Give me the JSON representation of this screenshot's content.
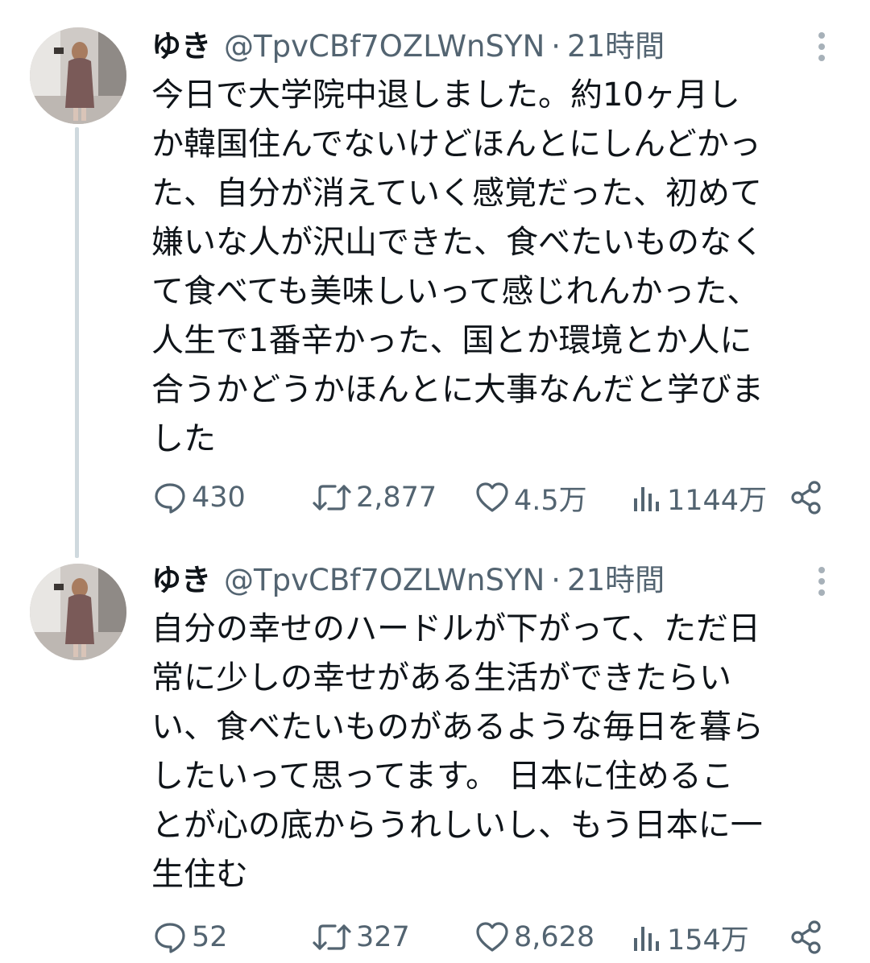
{
  "tweets": [
    {
      "display_name": "ゆき",
      "handle": "@TpvCBf7OZLWnSYN",
      "separator": "·",
      "time": "21時間",
      "text": "今日で大学院中退しました。約10ヶ月し\nか韓国住んでないけどほんとにしんどかっ\nた、自分が消えていく感覚だった、初めて\n嫌いな人が沢山できた、食べたいものなく\nて食べても美味しいって感じれんかった、\n人生で1番辛かった、国とか環境とか人に\n合うかどうかほんとに大事なんだと学びま\nした",
      "replies": "430",
      "retweets": "2,877",
      "likes": "4.5万",
      "views": "1144万"
    },
    {
      "display_name": "ゆき",
      "handle": "@TpvCBf7OZLWnSYN",
      "separator": "·",
      "time": "21時間",
      "text": "自分の幸せのハードルが下がって、ただ日\n常に少しの幸せがある生活ができたらい\nい、食べたいものがあるような毎日を暮ら\nしたいって思ってます。 日本に住めるこ\nとが心の底からうれしいし、もう日本に一\n生住む",
      "replies": "52",
      "retweets": "327",
      "likes": "8,628",
      "views": "154万"
    }
  ],
  "icons": {
    "reply": "speech-bubble-icon",
    "retweet": "retweet-arrows-icon",
    "like": "heart-outline-icon",
    "views": "bar-chart-icon",
    "share": "share-nodes-icon",
    "more": "vertical-ellipsis-icon"
  },
  "colors": {
    "text_primary": "#0f1419",
    "text_secondary": "#536471",
    "thread_line": "#cfd9de"
  }
}
